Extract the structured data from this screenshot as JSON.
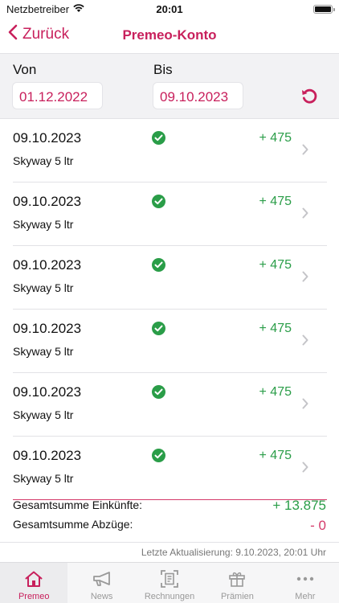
{
  "status_bar": {
    "carrier": "Netzbetreiber",
    "time": "20:01"
  },
  "nav": {
    "back_label": "Zurück",
    "title": "Premeo-Konto"
  },
  "filter": {
    "from_label": "Von",
    "from_value": "01.12.2022",
    "to_label": "Bis",
    "to_value": "09.10.2023"
  },
  "transactions": [
    {
      "date": "09.10.2023",
      "description": "Skyway 5 ltr",
      "amount": "+ 475",
      "status": "confirmed"
    },
    {
      "date": "09.10.2023",
      "description": "Skyway 5 ltr",
      "amount": "+ 475",
      "status": "confirmed"
    },
    {
      "date": "09.10.2023",
      "description": "Skyway 5 ltr",
      "amount": "+ 475",
      "status": "confirmed"
    },
    {
      "date": "09.10.2023",
      "description": "Skyway 5 ltr",
      "amount": "+ 475",
      "status": "confirmed"
    },
    {
      "date": "09.10.2023",
      "description": "Skyway 5 ltr",
      "amount": "+ 475",
      "status": "confirmed"
    },
    {
      "date": "09.10.2023",
      "description": "Skyway 5 ltr",
      "amount": "+ 475",
      "status": "confirmed"
    }
  ],
  "totals": {
    "income_label": "Gesamtsumme Einkünfte:",
    "income_value": "+ 13.875",
    "deductions_label": "Gesamtsumme Abzüge:",
    "deductions_value": "- 0"
  },
  "last_update": "Letzte Aktualisierung: 9.10.2023, 20:01 Uhr",
  "tabs": [
    {
      "label": "Premeo",
      "icon": "home-icon",
      "active": true
    },
    {
      "label": "News",
      "icon": "megaphone-icon",
      "active": false
    },
    {
      "label": "Rechnungen",
      "icon": "receipt-scan-icon",
      "active": false
    },
    {
      "label": "Prämien",
      "icon": "gift-icon",
      "active": false
    },
    {
      "label": "Mehr",
      "icon": "more-icon",
      "active": false
    }
  ],
  "colors": {
    "accent": "#c8205c",
    "positive": "#2a9d48",
    "negative": "#d43a6a",
    "muted": "#999999"
  }
}
